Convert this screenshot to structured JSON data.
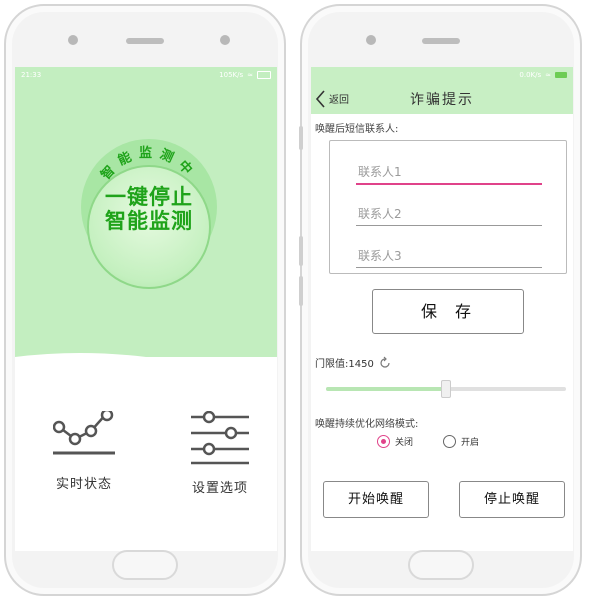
{
  "colors": {
    "accent_green": "#c3eec0",
    "text_green": "#1fa31a",
    "input_focus": "#e0438a"
  },
  "left_phone": {
    "status": {
      "time": "21:33",
      "speed": "105K/s"
    },
    "badge": {
      "arc_text": "智能监测中",
      "line1": "一键停止",
      "line2": "智能监测"
    },
    "menu": [
      {
        "label": "实时状态",
        "icon": "line-chart-icon"
      },
      {
        "label": "设置选项",
        "icon": "sliders-icon"
      }
    ]
  },
  "right_phone": {
    "status": {
      "speed": "0.0K/s"
    },
    "back_label": "返回",
    "title": "诈骗提示",
    "contacts_label": "唤醒后短信联系人:",
    "contacts": [
      {
        "placeholder": "联系人1",
        "value": ""
      },
      {
        "placeholder": "联系人2",
        "value": ""
      },
      {
        "placeholder": "联系人3",
        "value": ""
      }
    ],
    "save_label": "保存",
    "threshold_label": "门限值:1450",
    "threshold_value": 1450,
    "threshold_fraction": 0.5,
    "network_label": "唤醒持续优化网络模式:",
    "radio_options": [
      {
        "label": "关闭",
        "checked": true
      },
      {
        "label": "开启",
        "checked": false
      }
    ],
    "start_label": "开始唤醒",
    "stop_label": "停止唤醒"
  }
}
